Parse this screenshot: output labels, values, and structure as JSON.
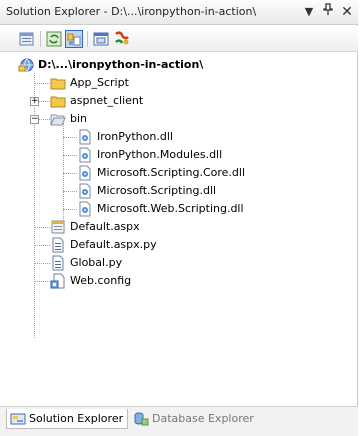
{
  "window": {
    "title": "Solution Explorer - D:\\...\\ironpython-in-action\\",
    "dropdown_icon": "chevron-down-icon",
    "pin_icon": "pin-icon",
    "close_icon": "close-icon"
  },
  "toolbar": {
    "buttons": [
      "properties",
      "refresh",
      "show-all-files",
      "view-designer",
      "ironpython"
    ]
  },
  "tree": {
    "root": "D:\\...\\ironpython-in-action\\",
    "items": [
      {
        "label": "App_Script",
        "icon": "folder-icon"
      },
      {
        "label": "aspnet_client",
        "icon": "folder-icon"
      },
      {
        "label": "bin",
        "icon": "open-folder-icon"
      },
      {
        "label": "IronPython.dll",
        "icon": "dll-icon"
      },
      {
        "label": "IronPython.Modules.dll",
        "icon": "dll-icon"
      },
      {
        "label": "Microsoft.Scripting.Core.dll",
        "icon": "dll-icon"
      },
      {
        "label": "Microsoft.Scripting.dll",
        "icon": "dll-icon"
      },
      {
        "label": "Microsoft.Web.Scripting.dll",
        "icon": "dll-icon"
      },
      {
        "label": "Default.aspx",
        "icon": "aspx-file-icon"
      },
      {
        "label": "Default.aspx.py",
        "icon": "file-icon"
      },
      {
        "label": "Global.py",
        "icon": "file-icon"
      },
      {
        "label": "Web.config",
        "icon": "config-file-icon"
      }
    ]
  },
  "tabs": [
    {
      "label": "Solution Explorer",
      "active": true
    },
    {
      "label": "Database Explorer",
      "active": false
    }
  ],
  "colors": {
    "selection": "#c1d2ee",
    "selection_border": "#316ac5",
    "folder": "#f4c84a"
  }
}
